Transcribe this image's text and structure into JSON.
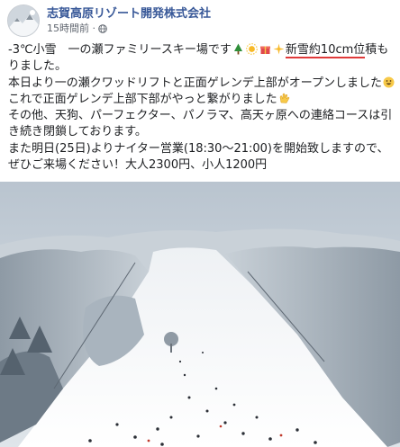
{
  "post": {
    "page_name": "志賀高原リゾート開発株式会社",
    "timestamp": "15時間前",
    "audience_icon": "globe-icon",
    "paragraphs": [
      {
        "before": "-3℃小雪　一の瀬ファミリースキー場です",
        "emojis": [
          "tree-emoji",
          "sun-emoji",
          "gift-emoji",
          "sparkle-emoji"
        ],
        "highlight": "新雪約10cm位",
        "after": "積もりました。"
      },
      {
        "text": "本日より一の瀬クワッドリフトと正面ゲレンデ上部がオープンしました",
        "emoji": "smile-emoji"
      },
      {
        "text": "これで正面ゲレンデ上部下部がやっと繋がりました",
        "emoji": "clap-emoji"
      },
      {
        "text": "その他、天狗、パーフェクター、パノラマ、高天ヶ原への連絡コースは引き続き閉鎖しております。"
      },
      {
        "text": "また明日(25日)よりナイター営業(18:30～21:00)を開始致しますので、ぜひご来場ください！大人2300円、小人1200円"
      }
    ]
  },
  "colors": {
    "name_blue": "#385898",
    "underline_red": "#e03a3a",
    "meta_gray": "#616770"
  }
}
